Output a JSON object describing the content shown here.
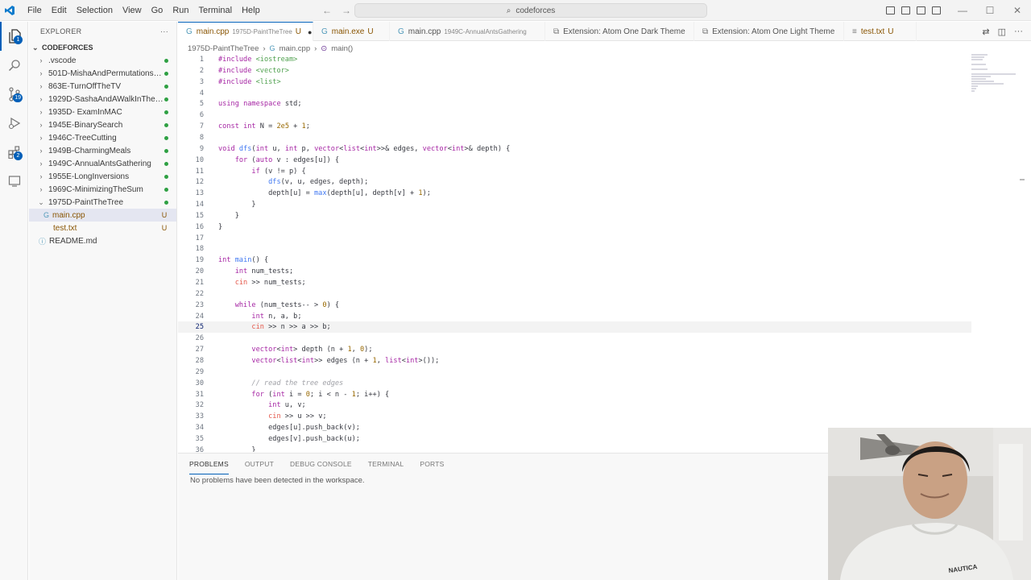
{
  "menu": [
    "File",
    "Edit",
    "Selection",
    "View",
    "Go",
    "Run",
    "Terminal",
    "Help"
  ],
  "search": {
    "text": "codeforces"
  },
  "activity": {
    "explorer_badge": "1",
    "scm_badge": "19",
    "ext_badge": "2"
  },
  "sidebar": {
    "title": "EXPLORER",
    "more": "···",
    "folder": "CODEFORCES",
    "items": [
      {
        "label": ".vscode",
        "status": "dot"
      },
      {
        "label": "501D-MishaAndPermutationsS...",
        "status": "dot"
      },
      {
        "label": "863E-TurnOffTheTV",
        "status": "dot"
      },
      {
        "label": "1929D-SashaAndAWalkInTheCity",
        "status": "dot"
      },
      {
        "label": "1935D- ExamInMAC",
        "status": "dot"
      },
      {
        "label": "1945E-BinarySearch",
        "status": "dot"
      },
      {
        "label": "1946C-TreeCutting",
        "status": "dot"
      },
      {
        "label": "1949B-CharmingMeals",
        "status": "dot"
      },
      {
        "label": "1949C-AnnualAntsGathering",
        "status": "dot"
      },
      {
        "label": "1955E-LongInversions",
        "status": "dot"
      },
      {
        "label": "1969C-MinimizingTheSum",
        "status": "dot"
      },
      {
        "label": "1975D-PaintTheTree",
        "status": "dot"
      }
    ],
    "children": [
      {
        "label": "main.cpp",
        "status": "U"
      },
      {
        "label": "test.txt",
        "status": "U"
      }
    ],
    "readme": "README.md"
  },
  "tabs": [
    {
      "label": "main.cpp",
      "desc": "1975D-PaintTheTree",
      "mod": "U",
      "dirty": "●"
    },
    {
      "label": "main.exe",
      "desc": "",
      "mod": "U",
      "dirty": ""
    },
    {
      "label": "main.cpp",
      "desc": "1949C-AnnualAntsGathering",
      "mod": "",
      "dirty": ""
    },
    {
      "label": "Extension: Atom One Dark Theme",
      "desc": "",
      "mod": "",
      "dirty": ""
    },
    {
      "label": "Extension: Atom One Light Theme",
      "desc": "",
      "mod": "",
      "dirty": ""
    },
    {
      "label": "test.txt",
      "desc": "",
      "mod": "U",
      "dirty": ""
    }
  ],
  "breadcrumb": [
    "1975D-PaintTheTree",
    "main.cpp",
    "main()"
  ],
  "code": [
    "#include <iostream>",
    "#include <vector>",
    "#include <list>",
    "",
    "using namespace std;",
    "",
    "const int N = 2e5 + 1;",
    "",
    "void dfs(int u, int p, vector<list<int>>& edges, vector<int>& depth) {",
    "    for (auto v : edges[u]) {",
    "        if (v != p) {",
    "            dfs(v, u, edges, depth);",
    "            depth[u] = max(depth[u], depth[v] + 1);",
    "        }",
    "    }",
    "}",
    "",
    "",
    "int main() {",
    "    int num_tests;",
    "    cin >> num_tests;",
    "",
    "    while (num_tests-- > 0) {",
    "        int n, a, b;",
    "        cin >> n >> a >> b;",
    "",
    "        vector<int> depth (n + 1, 0);",
    "        vector<list<int>> edges (n + 1, list<int>());",
    "",
    "        // read the tree edges",
    "        for (int i = 0; i < n - 1; i++) {",
    "            int u, v;",
    "            cin >> u >> v;",
    "            edges[u].push_back(v);",
    "            edges[v].push_back(u);",
    "        }"
  ],
  "current_line": 25,
  "panel": {
    "tabs": [
      "PROBLEMS",
      "OUTPUT",
      "DEBUG CONSOLE",
      "TERMINAL",
      "PORTS"
    ],
    "message": "No problems have been detected in the workspace."
  },
  "webcam": {
    "shirt_text": "NAUTICA"
  },
  "colors": {
    "accent": "#005fb8",
    "git_added": "#2ea043",
    "modified": "#895503"
  }
}
